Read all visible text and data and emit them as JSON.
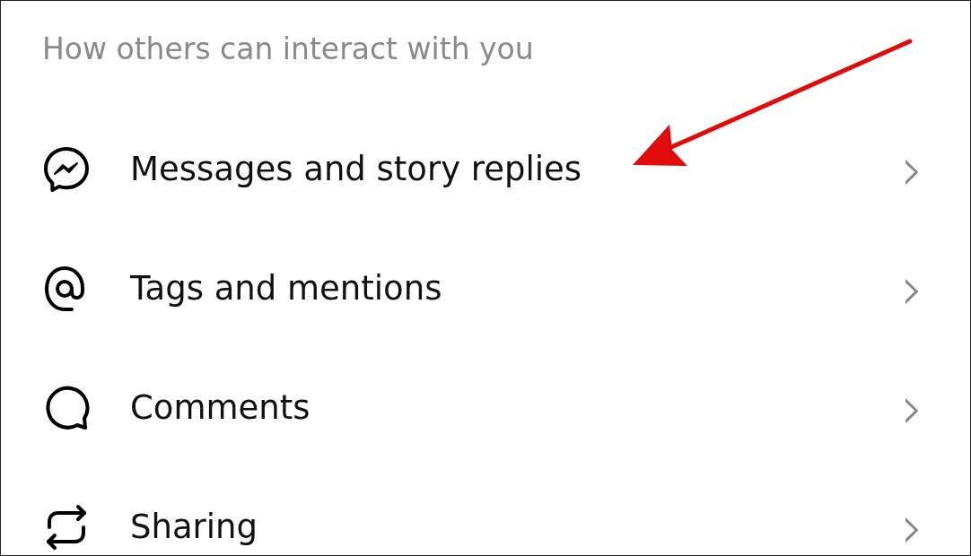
{
  "section": {
    "title": "How others can interact with you"
  },
  "items": [
    {
      "kind": "messenger",
      "label": "Messages and story replies",
      "chevron": "›"
    },
    {
      "kind": "mention",
      "label": "Tags and mentions",
      "chevron": "›"
    },
    {
      "kind": "comment",
      "label": "Comments",
      "chevron": "›"
    },
    {
      "kind": "repost",
      "label": "Sharing",
      "chevron": "›"
    }
  ],
  "annotations": [
    {
      "kind": "arrow",
      "color": "#e00c0c"
    }
  ]
}
